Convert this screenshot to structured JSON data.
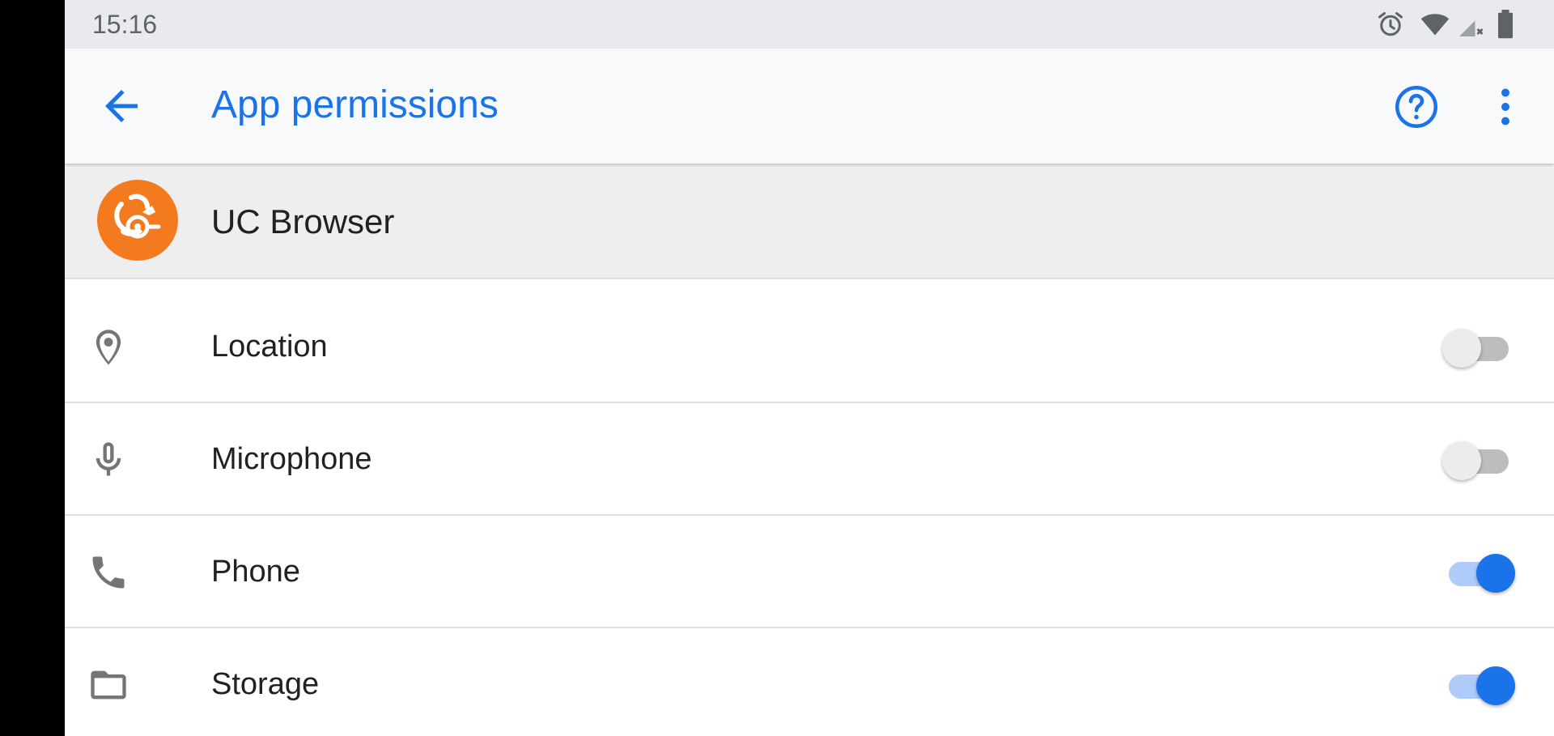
{
  "status_bar": {
    "time": "15:16",
    "icons": [
      "alarm-icon",
      "wifi-icon",
      "cell-signal-icon",
      "battery-icon"
    ]
  },
  "app_bar": {
    "title": "App permissions",
    "back_icon": "arrow-back-icon",
    "help_icon": "help-circle-icon",
    "more_icon": "more-vert-icon",
    "accent_color": "#1a73e8"
  },
  "app": {
    "name": "UC Browser",
    "icon_color": "#f47a20"
  },
  "permissions": [
    {
      "label": "Location",
      "icon": "location-pin-icon",
      "enabled": false
    },
    {
      "label": "Microphone",
      "icon": "microphone-icon",
      "enabled": false
    },
    {
      "label": "Phone",
      "icon": "phone-icon",
      "enabled": true
    },
    {
      "label": "Storage",
      "icon": "folder-icon",
      "enabled": true
    }
  ]
}
